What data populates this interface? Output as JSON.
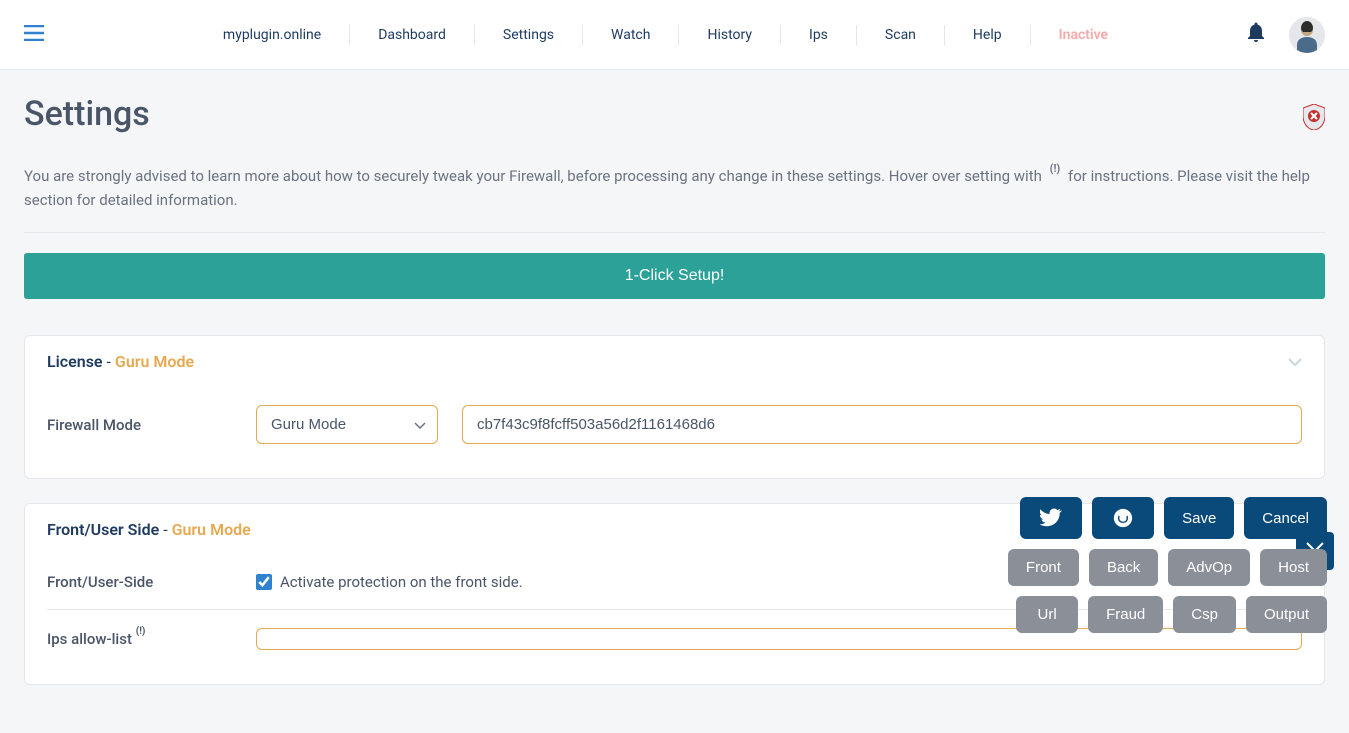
{
  "nav": {
    "site": "myplugin.online",
    "items": [
      "Dashboard",
      "Settings",
      "Watch",
      "History",
      "Ips",
      "Scan",
      "Help"
    ],
    "inactive": "Inactive"
  },
  "page": {
    "title": "Settings",
    "intro_before": "You are strongly advised to learn more about how to securely tweak your Firewall, before processing any change in these settings. Hover over setting with ",
    "intro_sup": "(!)",
    "intro_after": " for instructions. Please visit the help section for detailed information.",
    "one_click": "1-Click Setup!"
  },
  "license": {
    "title": "License",
    "mode": "Guru Mode",
    "firewall_mode_label": "Firewall Mode",
    "firewall_mode_value": "Guru Mode",
    "license_key": "cb7f43c9f8fcff503a56d2f1161468d6"
  },
  "front": {
    "title": "Front/User Side",
    "mode": "Guru Mode",
    "front_label": "Front/User-Side",
    "activate_label": "Activate protection on the front side.",
    "ips_allow_label": "Ips allow-list",
    "ips_sup": "(!)"
  },
  "actions": {
    "save": "Save",
    "cancel": "Cancel",
    "front": "Front",
    "back": "Back",
    "advop": "AdvOp",
    "host": "Host",
    "url": "Url",
    "fraud": "Fraud",
    "csp": "Csp",
    "output": "Output"
  }
}
